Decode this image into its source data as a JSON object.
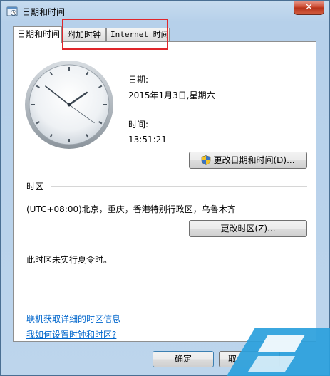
{
  "window": {
    "title": "日期和时间",
    "close_symbol": "✕"
  },
  "tabs": [
    {
      "label": "日期和时间"
    },
    {
      "label": "附加时钟"
    },
    {
      "label": "Internet 时间"
    }
  ],
  "datetime": {
    "date_label": "日期:",
    "date_value": "2015年1月3日,星期六",
    "time_label": "时间:",
    "time_value": "13:51:21",
    "change_button": "更改日期和时间(D)..."
  },
  "timezone": {
    "section_label": "时区",
    "value": "(UTC+08:00)北京，重庆，香港特别行政区，乌鲁木齐",
    "change_button": "更改时区(Z)...",
    "dst_note": "此时区未实行夏令时。"
  },
  "links": {
    "online_info": "联机获取详细的时区信息",
    "how_to_set": "我如何设置时钟和时区?"
  },
  "buttons": {
    "ok": "确定",
    "cancel": "取"
  },
  "clock": {
    "hours": 13,
    "minutes": 51,
    "seconds": 21
  },
  "colors": {
    "highlight_box": "#e0262b",
    "link": "#0066cc"
  },
  "icons": [
    "app-icon",
    "close-icon",
    "shield-icon",
    "clock-icon",
    "watermark-logo"
  ]
}
